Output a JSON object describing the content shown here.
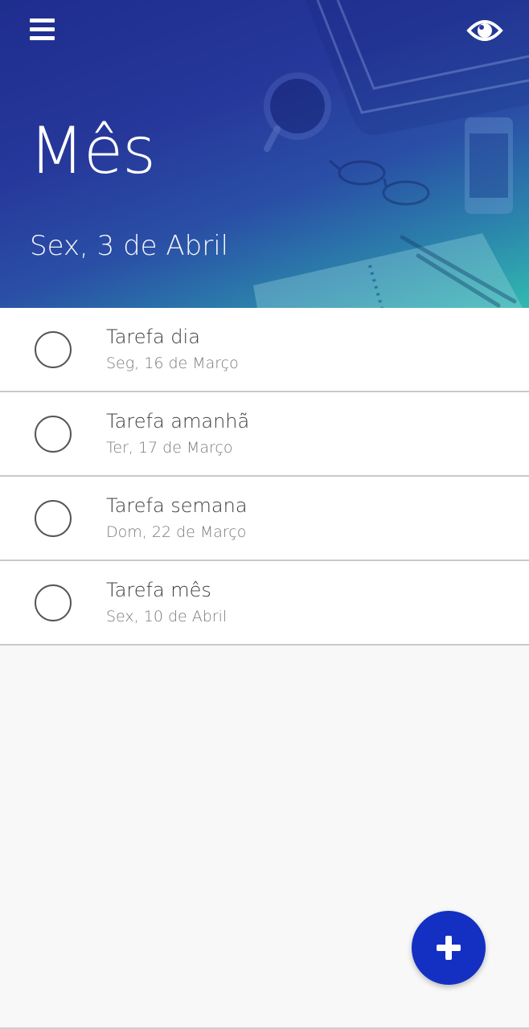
{
  "header": {
    "title": "Mês",
    "date": "Sex, 3 de Abril",
    "menu_icon": "hamburger-menu-icon",
    "visibility_icon": "eye-icon",
    "gradient_colors": [
      "#1e2d8e",
      "#2a4fa6",
      "#32b9b0"
    ]
  },
  "tasks": [
    {
      "title": "Tarefa dia",
      "date": "Seg, 16 de Março"
    },
    {
      "title": "Tarefa amanhã",
      "date": "Ter, 17 de Março"
    },
    {
      "title": "Tarefa semana",
      "date": "Dom, 22 de Março"
    },
    {
      "title": "Tarefa mês",
      "date": "Sex, 10 de Abril"
    }
  ],
  "fab": {
    "icon": "plus-icon",
    "color": "#1330c2"
  }
}
